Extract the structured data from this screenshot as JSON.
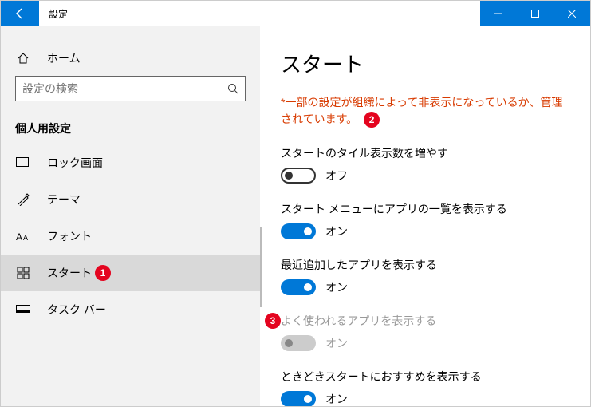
{
  "titlebar": {
    "title": "設定"
  },
  "sidebar": {
    "home": "ホーム",
    "search_placeholder": "設定の検索",
    "section": "個人用設定",
    "items": [
      {
        "label": "ロック画面"
      },
      {
        "label": "テーマ"
      },
      {
        "label": "フォント"
      },
      {
        "label": "スタート"
      },
      {
        "label": "タスク バー"
      }
    ]
  },
  "content": {
    "heading": "スタート",
    "warning": "*一部の設定が組織によって非表示になっているか、管理されています。",
    "settings": [
      {
        "label": "スタートのタイル表示数を増やす",
        "state": "オフ"
      },
      {
        "label": "スタート メニューにアプリの一覧を表示する",
        "state": "オン"
      },
      {
        "label": "最近追加したアプリを表示する",
        "state": "オン"
      },
      {
        "label": "よく使われるアプリを表示する",
        "state": "オン"
      },
      {
        "label": "ときどきスタートにおすすめを表示する",
        "state": "オン"
      }
    ]
  },
  "annotations": {
    "b1": "1",
    "b2": "2",
    "b3": "3"
  }
}
